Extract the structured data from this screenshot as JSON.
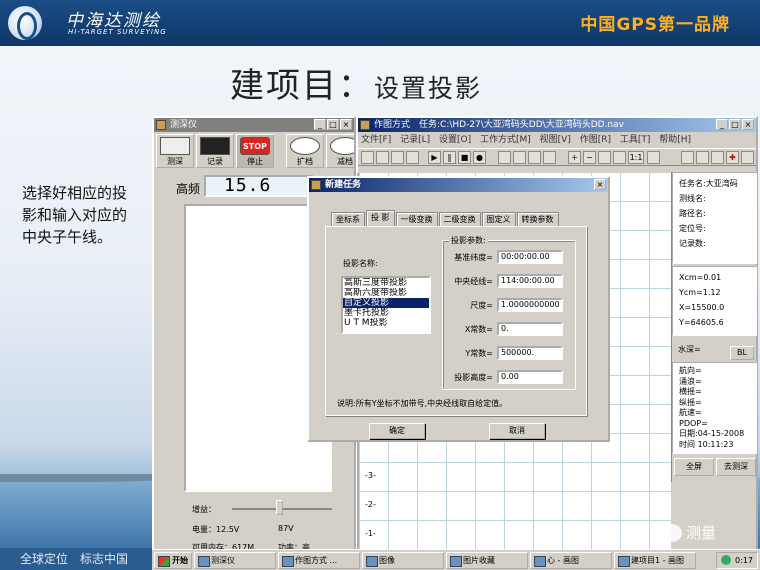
{
  "header": {
    "brand_cn": "中海达测绘",
    "brand_en": "HI-TARGET SURVEYING",
    "slogan": "中国GPS第一品牌"
  },
  "slide": {
    "title_main": "建项目：",
    "title_sub": "设置投影",
    "description": "选择好相应的投影和输入对应的中央子午线。"
  },
  "footer": {
    "text": "全球定位　标志中国"
  },
  "sounder": {
    "title": "测深仪",
    "buttons": [
      "测深",
      "记录",
      "停止",
      "扩档",
      "减档"
    ],
    "stop_text": "STOP",
    "freq_label": "高频",
    "freq_value": "15.6",
    "gain_label": "增益：",
    "voltage_label": "电量：12.5V",
    "voltage2": "87V",
    "memory_label": "可用内存：617M",
    "power_label": "功率：高"
  },
  "mapping": {
    "title": "作图方式　任务:C:\\HD-27\\大亚湾码头DD\\大亚湾码头DD.nav",
    "menus": [
      "文件[F]",
      "记录[L]",
      "设置[O]",
      "工作方式[M]",
      "视图[V]",
      "作图[R]",
      "工具[T]",
      "帮助[H]"
    ],
    "zoom_text": "1:1",
    "ticks": [
      "-3-",
      "-2-",
      "-1-"
    ],
    "info1": [
      "任务名:大亚湾码",
      "测线名:",
      "路径名:",
      "定位号:",
      "记录数:"
    ],
    "info2": [
      "Xcm=0.01",
      "Ycm=1.12",
      "X=15500.0",
      "Y=64605.6"
    ],
    "depth_label": "水深=",
    "bl_button": "BL",
    "info3": [
      "航向=",
      "涌浪=",
      "横摇=",
      "纵摇=",
      "航速=",
      "PDOP=",
      "日期:04-15-2008",
      "时间 10:11:23"
    ],
    "fullscreen_button": "全屏",
    "to_sounder_button": "去测深"
  },
  "dialog": {
    "title": "新建任务",
    "tabs": [
      "坐标系",
      "投 影",
      "一级变换",
      "二级变换",
      "图定义",
      "转换参数"
    ],
    "proj_name_label": "投影名称:",
    "projections": [
      "高斯三度带投影",
      "高斯六度带投影",
      "自定义投影",
      "墨卡托投影",
      "U T M投影"
    ],
    "selected_index": 2,
    "params_title": "投影参数:",
    "fields": [
      {
        "label": "基准纬度=",
        "value": "00:00:00.00"
      },
      {
        "label": "中央经线=",
        "value": "114:00:00.00"
      },
      {
        "label": "尺度=",
        "value": "1.0000000000"
      },
      {
        "label": "X常数=",
        "value": "0."
      },
      {
        "label": "Y常数=",
        "value": "500000."
      },
      {
        "label": "投影高度=",
        "value": "0.00"
      }
    ],
    "note": "说明:所有Y坐标不加带号,中央经线取自给定值。",
    "ok_button": "确定",
    "cancel_button": "取消"
  },
  "taskbar": {
    "start": "开始",
    "items": [
      "测深仪",
      "作图方式 ...",
      "图像",
      "图片收藏",
      "心 - 画图",
      "建项目1 - 画图"
    ],
    "clock": "0:17"
  },
  "watermark": "测量"
}
